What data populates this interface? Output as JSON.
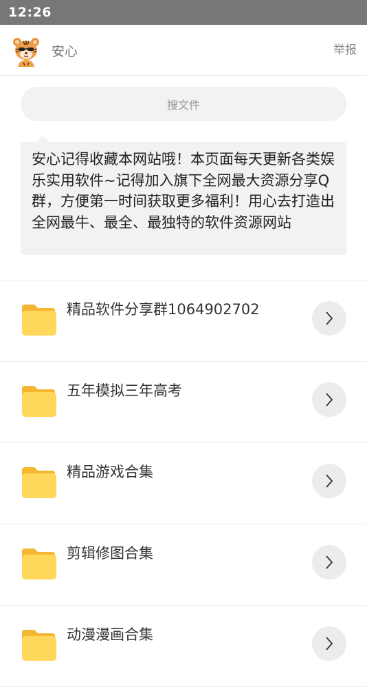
{
  "status_bar": {
    "time": "12:26"
  },
  "header": {
    "username": "安心",
    "report_label": "举报"
  },
  "search": {
    "placeholder": "搜文件"
  },
  "notice": {
    "text": "安心记得收藏本网站哦！本页面每天更新各类娱乐实用软件~记得加入旗下全网最大资源分享Q群，方便第一时间获取更多福利！用心去打造出全网最牛、最全、最独特的软件资源网站"
  },
  "folders": [
    {
      "name": "精品软件分享群1064902702"
    },
    {
      "name": "五年模拟三年高考"
    },
    {
      "name": "精品游戏合集"
    },
    {
      "name": "剪辑修图合集"
    },
    {
      "name": "动漫漫画合集"
    }
  ],
  "colors": {
    "status_bar_bg": "#777777",
    "folder_front": "#FFD75A",
    "folder_back": "#F5B731",
    "chevron_bg": "#ECECEC",
    "panel_bg": "#F2F2F2"
  },
  "icons": {
    "avatar": "tiger-avatar-icon",
    "folder": "folder-icon",
    "chevron": "chevron-right-icon"
  }
}
